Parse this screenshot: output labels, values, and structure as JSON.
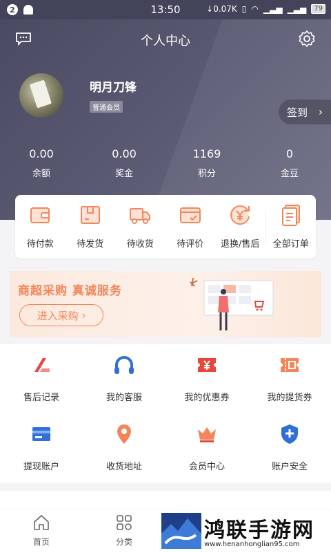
{
  "status_bar": {
    "badge": "2",
    "time": "13:50",
    "speed": "0.07K",
    "battery": "79"
  },
  "header": {
    "title": "个人中心",
    "username": "明月刀锋",
    "member_level": "普通会员",
    "checkin_label": "签到"
  },
  "stats": [
    {
      "value": "0.00",
      "label": "余额"
    },
    {
      "value": "0.00",
      "label": "奖金"
    },
    {
      "value": "1169",
      "label": "积分"
    },
    {
      "value": "0",
      "label": "金豆"
    }
  ],
  "orders": [
    {
      "label": "待付款",
      "icon": "wallet-icon"
    },
    {
      "label": "待发货",
      "icon": "package-icon"
    },
    {
      "label": "待收货",
      "icon": "truck-icon"
    },
    {
      "label": "待评价",
      "icon": "review-card-icon"
    },
    {
      "label": "退换/售后",
      "icon": "yen-return-icon"
    },
    {
      "label": "全部订单",
      "icon": "orders-list-icon"
    }
  ],
  "banner": {
    "title": "商超采购 真诚服务",
    "button": "进入采购"
  },
  "services": [
    {
      "label": "售后记录",
      "icon": "after-sale-icon"
    },
    {
      "label": "我的客服",
      "icon": "headset-icon"
    },
    {
      "label": "我的优惠券",
      "icon": "coupon-icon"
    },
    {
      "label": "我的提货券",
      "icon": "pickup-ticket-icon"
    },
    {
      "label": "提现账户",
      "icon": "card-icon"
    },
    {
      "label": "收货地址",
      "icon": "location-icon"
    },
    {
      "label": "会员中心",
      "icon": "crown-icon"
    },
    {
      "label": "账户安全",
      "icon": "shield-icon"
    }
  ],
  "tabs": [
    {
      "label": "首页",
      "icon": "home-icon"
    },
    {
      "label": "分类",
      "icon": "category-icon"
    }
  ],
  "watermark": {
    "text": "鸿联手游网",
    "url": "www.henanhonglian95.com"
  },
  "colors": {
    "header": "#4a4a63",
    "accent": "#f2865a",
    "red": "#e8453c",
    "blue": "#2f6fd6"
  }
}
